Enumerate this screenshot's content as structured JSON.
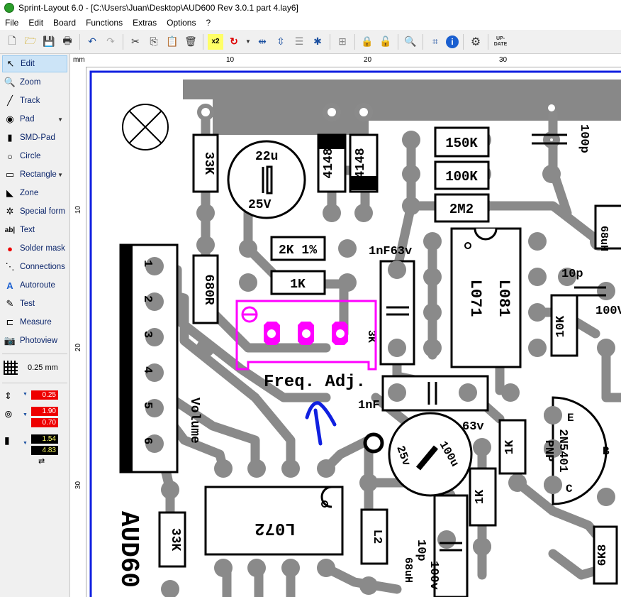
{
  "window": {
    "title": "Sprint-Layout 6.0 - [C:\\Users\\Juan\\Desktop\\AUD600 Rev 3.0.1 part 4.lay6]"
  },
  "menu": [
    "File",
    "Edit",
    "Board",
    "Functions",
    "Extras",
    "Options",
    "?"
  ],
  "toolbar": {
    "x2_label": "x2",
    "update_label": "UP-DATE"
  },
  "sidebar": {
    "items": [
      {
        "label": "Edit",
        "icon": "cursor-arrow-icon"
      },
      {
        "label": "Zoom",
        "icon": "magnifier-icon"
      },
      {
        "label": "Track",
        "icon": "track-icon"
      },
      {
        "label": "Pad",
        "icon": "pad-icon"
      },
      {
        "label": "SMD-Pad",
        "icon": "smd-pad-icon"
      },
      {
        "label": "Circle",
        "icon": "circle-icon"
      },
      {
        "label": "Rectangle",
        "icon": "rectangle-icon"
      },
      {
        "label": "Zone",
        "icon": "zone-icon"
      },
      {
        "label": "Special form",
        "icon": "special-form-icon"
      },
      {
        "label": "Text",
        "icon": "text-icon"
      },
      {
        "label": "Solder mask",
        "icon": "solder-mask-icon"
      },
      {
        "label": "Connections",
        "icon": "connections-icon"
      },
      {
        "label": "Autoroute",
        "icon": "autoroute-icon"
      },
      {
        "label": "Test",
        "icon": "test-icon"
      },
      {
        "label": "Measure",
        "icon": "measure-icon"
      },
      {
        "label": "Photoview",
        "icon": "photoview-icon"
      }
    ],
    "grid": "0.25 mm",
    "track_width": "0.25",
    "pad_outer": "1.90",
    "pad_inner": "0.70",
    "smd_w": "1.54",
    "smd_h": "4.83"
  },
  "ruler": {
    "unit": "mm",
    "top_ticks": [
      "10",
      "20",
      "30"
    ],
    "left_ticks": [
      "10",
      "20",
      "30"
    ]
  },
  "board": {
    "resistors": [
      "33K",
      "2K 1%",
      "1K",
      "680R",
      "150K",
      "100K",
      "2M2",
      "10K",
      "1K",
      "1K",
      "33K",
      "6K8",
      "L2"
    ],
    "capacitors": [
      "22u",
      "25V",
      "1nF63v",
      "1nF",
      "63v",
      "10p",
      "100V",
      "100p",
      "100u",
      "25v",
      "10p",
      "100v"
    ],
    "diodes": [
      "4148",
      "4148"
    ],
    "ics": [
      "L081",
      "L071",
      "L072"
    ],
    "transistor": [
      "2N5401",
      "PNP",
      "E",
      "B",
      "C"
    ],
    "inductors": [
      "68uH",
      "68uH"
    ],
    "pot_label": "3K",
    "volume_label": "Volume",
    "connector_pins": [
      "1",
      "2",
      "3",
      "4",
      "5",
      "6"
    ],
    "freq_label": "Freq. Adj.",
    "board_name": "AUD60"
  }
}
